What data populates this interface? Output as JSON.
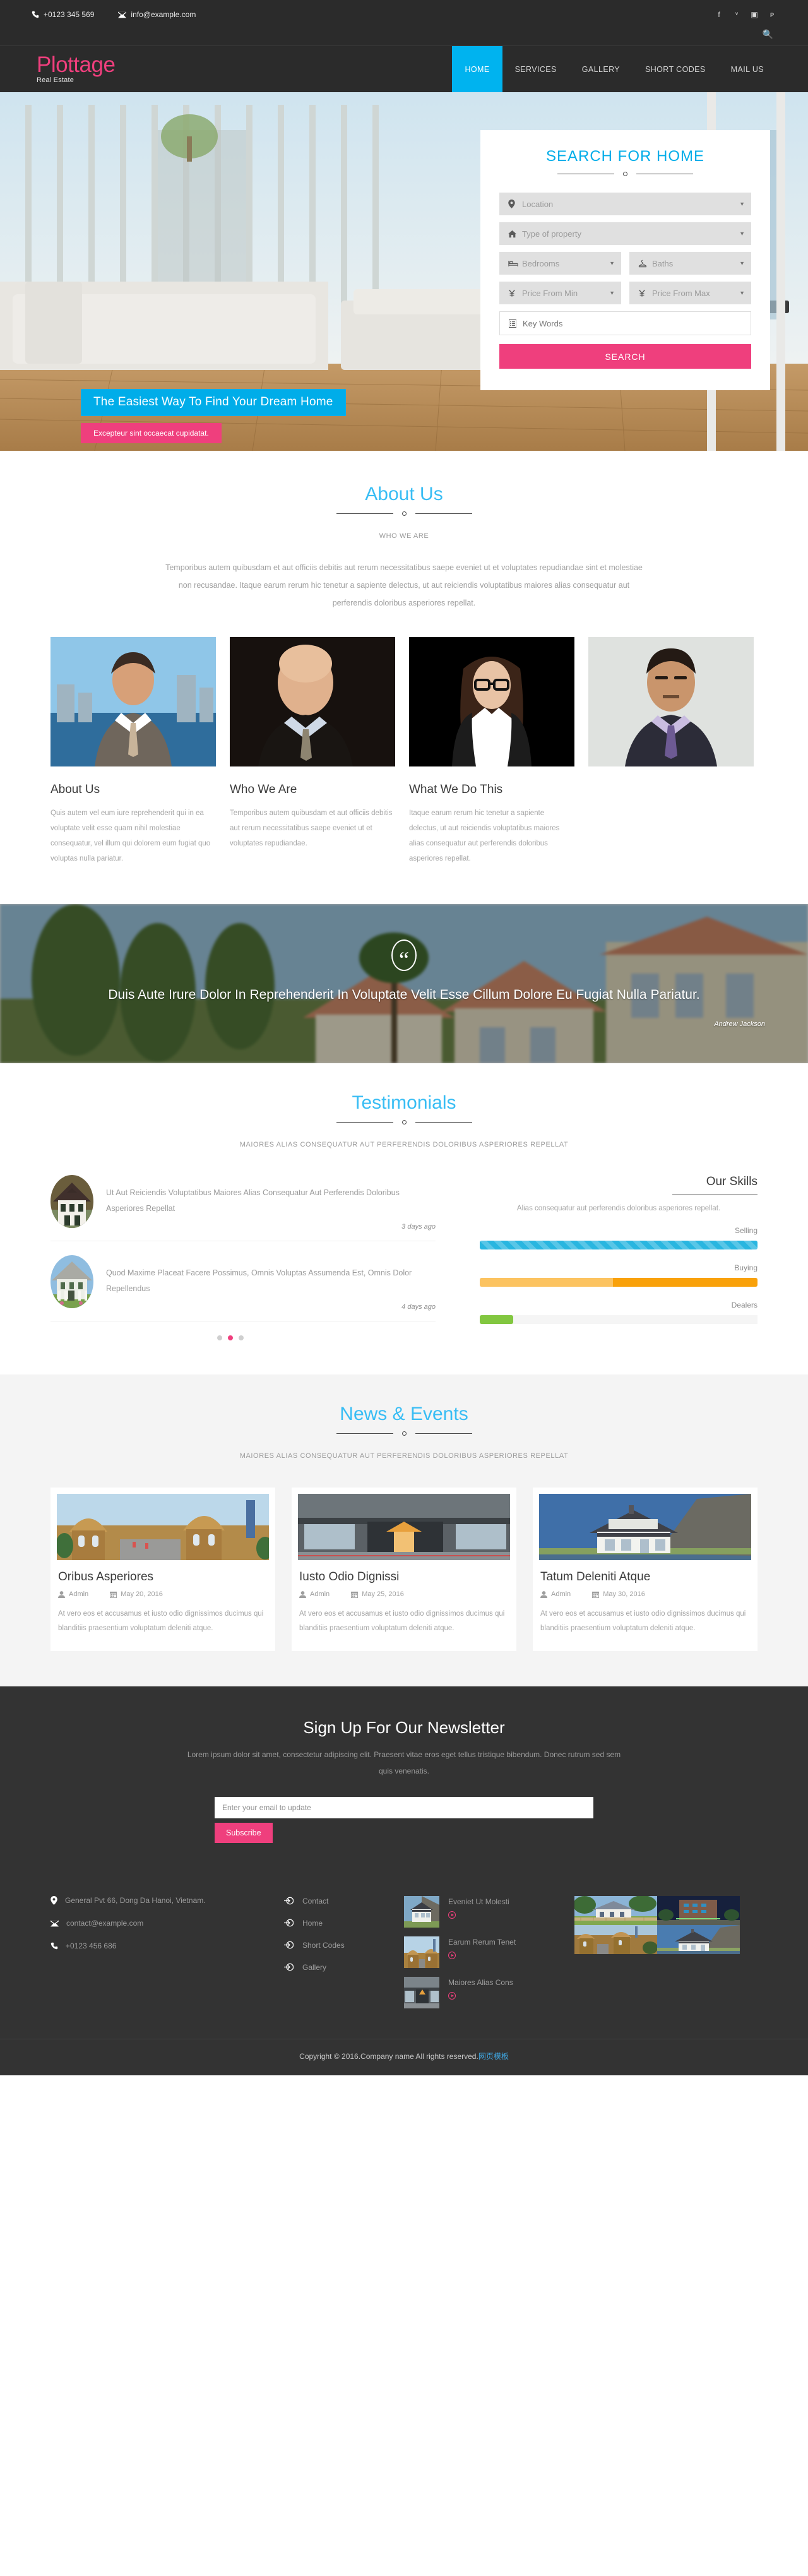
{
  "topbar": {
    "phone": "+0123 345 569",
    "email": "info@example.com",
    "social": [
      {
        "name": "facebook-icon",
        "glyph": "f"
      },
      {
        "name": "twitter-icon",
        "glyph": "ᵛ"
      },
      {
        "name": "instagram-icon",
        "glyph": "▣"
      },
      {
        "name": "pinterest-icon",
        "glyph": "ᴘ"
      }
    ],
    "search_icon": "search-icon"
  },
  "brand": {
    "logo": "Plottage",
    "tagline": "Real Estate"
  },
  "nav": {
    "items": [
      {
        "label": "HOME",
        "active": true
      },
      {
        "label": "SERVICES",
        "active": false
      },
      {
        "label": "GALLERY",
        "active": false
      },
      {
        "label": "SHORT CODES",
        "active": false
      },
      {
        "label": "MAIL US",
        "active": false
      }
    ]
  },
  "hero": {
    "caption_main": "The Easiest Way To Find Your Dream Home",
    "caption_sub": "Excepteur sint occaecat cupidatat."
  },
  "search_form": {
    "title": "SEARCH FOR HOME",
    "fields": [
      {
        "icon": "location-pin-icon",
        "placeholder": "Location"
      },
      {
        "icon": "home-icon",
        "placeholder": "Type of property"
      },
      {
        "icon": "bed-icon",
        "placeholder": "Bedrooms"
      },
      {
        "icon": "hanger-icon",
        "placeholder": "Baths"
      },
      {
        "icon": "yen-icon",
        "placeholder": "Price From Min"
      },
      {
        "icon": "yen-icon",
        "placeholder": "Price From Max"
      },
      {
        "icon": "list-icon",
        "placeholder": "Key Words"
      }
    ],
    "submit_label": "SEARCH"
  },
  "about": {
    "title": "About Us",
    "subtitle": "WHO WE ARE",
    "intro": "Temporibus autem quibusdam et aut officiis debitis aut rerum necessitatibus saepe eveniet ut et voluptates repudiandae sint et molestiae non recusandae. Itaque earum rerum hic tenetur a sapiente delectus, ut aut reiciendis voluptatibus maiores alias consequatur aut perferendis doloribus asperiores repellat.",
    "columns": [
      {
        "heading": "About Us",
        "body": "Quis autem vel eum iure reprehenderit qui in ea voluptate velit esse quam nihil molestiae consequatur, vel illum qui dolorem eum fugiat quo voluptas nulla pariatur."
      },
      {
        "heading": "Who We Are",
        "body": "Temporibus autem quibusdam et aut officiis debitis aut rerum necessitatibus saepe eveniet ut et voluptates repudiandae."
      },
      {
        "heading": "What We Do This",
        "body": "Itaque earum rerum hic tenetur a sapiente delectus, ut aut reiciendis voluptatibus maiores alias consequatur aut perferendis doloribus asperiores repellat."
      }
    ]
  },
  "quote": {
    "mark": "“",
    "text": "Duis Aute Irure Dolor In Reprehenderit In Voluptate Velit Esse Cillum Dolore Eu Fugiat Nulla Pariatur.",
    "author": "Andrew Jackson"
  },
  "testimonials": {
    "title": "Testimonials",
    "subtitle": "MAIORES ALIAS CONSEQUATUR AUT PERFERENDIS DOLORIBUS ASPERIORES REPELLAT",
    "items": [
      {
        "text": "Ut Aut Reiciendis Voluptatibus Maiores Alias Consequatur Aut Perferendis Doloribus Asperiores Repellat",
        "ago": "3 days ago"
      },
      {
        "text": "Quod Maxime Placeat Facere Possimus, Omnis Voluptas Assumenda Est, Omnis Dolor Repellendus",
        "ago": "4 days ago"
      }
    ],
    "dots_active_index": 1
  },
  "skills": {
    "title": "Our Skills",
    "subtitle": "Alias consequatur aut perferendis doloribus asperiores repellat.",
    "chart_data": {
      "type": "bar",
      "title": "Our Skills",
      "categories": [
        "Selling",
        "Buying",
        "Dealers"
      ],
      "values": [
        100,
        100,
        12
      ],
      "bar_fill_secondary": [
        0,
        48,
        0
      ],
      "colors": [
        "#29b6e0",
        "#f9a10a",
        "#82c740"
      ],
      "xlabel": "",
      "ylabel": "",
      "ylim": [
        0,
        100
      ],
      "grid": false,
      "legend": "none"
    }
  },
  "news": {
    "title": "News & Events",
    "subtitle": "MAIORES ALIAS CONSEQUATUR AUT PERFERENDIS DOLORIBUS ASPERIORES REPELLAT",
    "cards": [
      {
        "title": "Oribus Asperiores",
        "author": "Admin",
        "date": "May 20, 2016",
        "body": "At vero eos et accusamus et iusto odio dignissimos ducimus qui blanditiis praesentium voluptatum deleniti atque."
      },
      {
        "title": "Iusto Odio Dignissi",
        "author": "Admin",
        "date": "May 25, 2016",
        "body": "At vero eos et accusamus et iusto odio dignissimos ducimus qui blanditiis praesentium voluptatum deleniti atque."
      },
      {
        "title": "Tatum Deleniti Atque",
        "author": "Admin",
        "date": "May 30, 2016",
        "body": "At vero eos et accusamus et iusto odio dignissimos ducimus qui blanditiis praesentium voluptatum deleniti atque."
      }
    ]
  },
  "newsletter": {
    "title": "Sign Up For Our Newsletter",
    "body": "Lorem ipsum dolor sit amet, consectetur adipiscing elit. Praesent vitae eros eget tellus tristique bibendum. Donec rutrum sed sem quis venenatis.",
    "placeholder": "Enter your email to update",
    "button": "Subscribe"
  },
  "footer": {
    "address": "General Pvt 66, Dong Da Hanoi, Vietnam.",
    "email": "contact@example.com",
    "phone": "+0123 456 686",
    "links": [
      {
        "label": "Contact"
      },
      {
        "label": "Home"
      },
      {
        "label": "Short Codes"
      },
      {
        "label": "Gallery"
      }
    ],
    "posts": [
      {
        "title": "Eveniet Ut Molesti"
      },
      {
        "title": "Earum Rerum Tenet"
      },
      {
        "title": "Maiores Alias Cons"
      }
    ]
  },
  "copyright": {
    "text": "Copyright © 2016.Company name All rights reserved.",
    "link": "网页模板"
  },
  "colors": {
    "accent_pink": "#ef3f7d",
    "accent_blue": "#00ade9",
    "dark": "#2b2b2b",
    "footer_dark": "#333333"
  }
}
